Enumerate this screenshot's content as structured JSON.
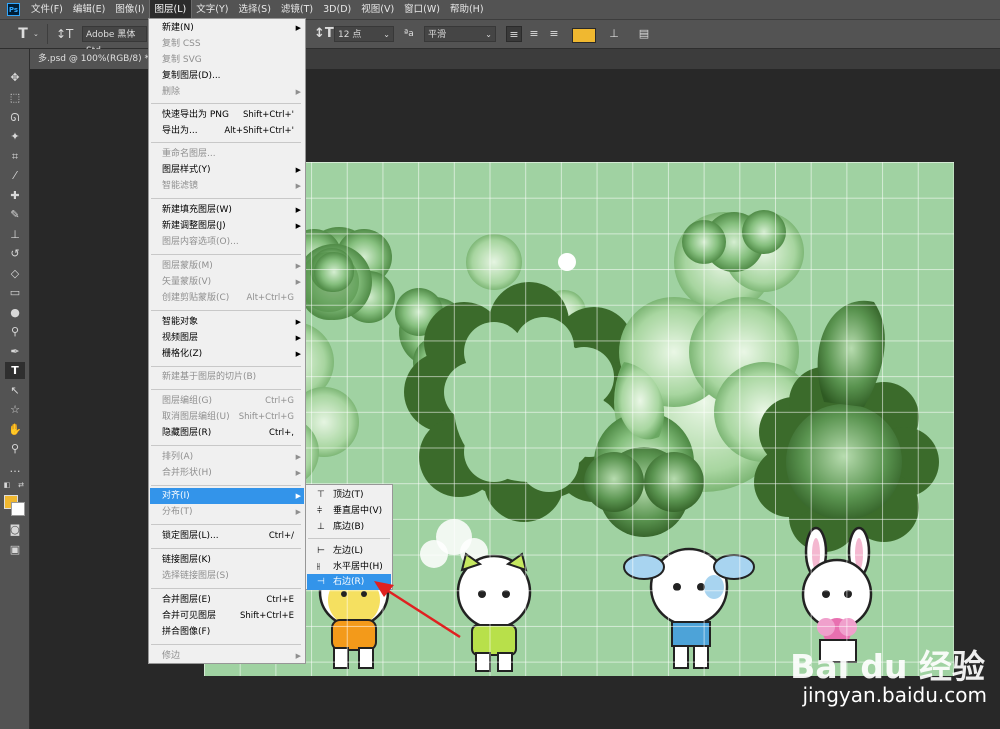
{
  "menubar": {
    "logo": "Ps",
    "items": [
      "文件(F)",
      "编辑(E)",
      "图像(I)",
      "图层(L)",
      "文字(Y)",
      "选择(S)",
      "滤镜(T)",
      "3D(D)",
      "视图(V)",
      "窗口(W)",
      "帮助(H)"
    ]
  },
  "options": {
    "font_family": "Adobe 黑体 Std",
    "font_size": "12 点",
    "antialias_icon": "ªa",
    "antialias": "平滑",
    "text_color": "#f0b830"
  },
  "document": {
    "tab_title": "多.psd @ 100%(RGB/8) *"
  },
  "layer_menu": {
    "items": [
      {
        "label": "新建(N)",
        "shortcut": "",
        "arrow": true,
        "disabled": false,
        "y": 0
      },
      {
        "label": "复制 CSS",
        "shortcut": "",
        "arrow": false,
        "disabled": true
      },
      {
        "label": "复制 SVG",
        "shortcut": "",
        "arrow": false,
        "disabled": true
      },
      {
        "label": "复制图层(D)...",
        "shortcut": "",
        "arrow": false,
        "disabled": false
      },
      {
        "label": "删除",
        "shortcut": "",
        "arrow": true,
        "disabled": true
      },
      {
        "label": "快速导出为 PNG",
        "shortcut": "Shift+Ctrl+'",
        "arrow": false,
        "disabled": false
      },
      {
        "label": "导出为...",
        "shortcut": "Alt+Shift+Ctrl+'",
        "arrow": false,
        "disabled": false
      },
      {
        "label": "重命名图层...",
        "shortcut": "",
        "arrow": false,
        "disabled": true
      },
      {
        "label": "图层样式(Y)",
        "shortcut": "",
        "arrow": true,
        "disabled": false
      },
      {
        "label": "智能滤镜",
        "shortcut": "",
        "arrow": true,
        "disabled": true
      },
      {
        "label": "新建填充图层(W)",
        "shortcut": "",
        "arrow": true,
        "disabled": false
      },
      {
        "label": "新建调整图层(J)",
        "shortcut": "",
        "arrow": true,
        "disabled": false
      },
      {
        "label": "图层内容选项(O)...",
        "shortcut": "",
        "arrow": false,
        "disabled": true
      },
      {
        "label": "图层蒙版(M)",
        "shortcut": "",
        "arrow": true,
        "disabled": true
      },
      {
        "label": "矢量蒙版(V)",
        "shortcut": "",
        "arrow": true,
        "disabled": true
      },
      {
        "label": "创建剪贴蒙版(C)",
        "shortcut": "Alt+Ctrl+G",
        "arrow": false,
        "disabled": true
      },
      {
        "label": "智能对象",
        "shortcut": "",
        "arrow": true,
        "disabled": false
      },
      {
        "label": "视频图层",
        "shortcut": "",
        "arrow": true,
        "disabled": false
      },
      {
        "label": "栅格化(Z)",
        "shortcut": "",
        "arrow": true,
        "disabled": false
      },
      {
        "label": "新建基于图层的切片(B)",
        "shortcut": "",
        "arrow": false,
        "disabled": true
      },
      {
        "label": "图层编组(G)",
        "shortcut": "Ctrl+G",
        "arrow": false,
        "disabled": true
      },
      {
        "label": "取消图层编组(U)",
        "shortcut": "Shift+Ctrl+G",
        "arrow": false,
        "disabled": true
      },
      {
        "label": "隐藏图层(R)",
        "shortcut": "Ctrl+,",
        "arrow": false,
        "disabled": false
      },
      {
        "label": "排列(A)",
        "shortcut": "",
        "arrow": true,
        "disabled": true
      },
      {
        "label": "合并形状(H)",
        "shortcut": "",
        "arrow": true,
        "disabled": true
      },
      {
        "label": "对齐(I)",
        "shortcut": "",
        "arrow": true,
        "disabled": false,
        "highlighted": true
      },
      {
        "label": "分布(T)",
        "shortcut": "",
        "arrow": true,
        "disabled": true
      },
      {
        "label": "锁定图层(L)...",
        "shortcut": "Ctrl+/",
        "arrow": false,
        "disabled": false
      },
      {
        "label": "链接图层(K)",
        "shortcut": "",
        "arrow": false,
        "disabled": false
      },
      {
        "label": "选择链接图层(S)",
        "shortcut": "",
        "arrow": false,
        "disabled": true
      },
      {
        "label": "合并图层(E)",
        "shortcut": "Ctrl+E",
        "arrow": false,
        "disabled": false
      },
      {
        "label": "合并可见图层",
        "shortcut": "Shift+Ctrl+E",
        "arrow": false,
        "disabled": false
      },
      {
        "label": "拼合图像(F)",
        "shortcut": "",
        "arrow": false,
        "disabled": false
      },
      {
        "label": "修边",
        "shortcut": "",
        "arrow": true,
        "disabled": true
      }
    ]
  },
  "align_menu": {
    "items": [
      {
        "label": "顶边(T)",
        "icon": "align-top-icon"
      },
      {
        "label": "垂直居中(V)",
        "icon": "align-vcenter-icon"
      },
      {
        "label": "底边(B)",
        "icon": "align-bottom-icon"
      },
      {
        "label": "左边(L)",
        "icon": "align-left-icon"
      },
      {
        "label": "水平居中(H)",
        "icon": "align-hcenter-icon"
      },
      {
        "label": "右边(R)",
        "icon": "align-right-icon",
        "highlighted": true
      }
    ]
  },
  "watermark": {
    "logo": "Bai du 经验",
    "url": "jingyan.baidu.com"
  },
  "colors": {
    "highlight": "#3394ea",
    "canvas_bg": "#a0d2a2",
    "dark_green": "#3c6b2c",
    "arrow": "#e02020"
  }
}
